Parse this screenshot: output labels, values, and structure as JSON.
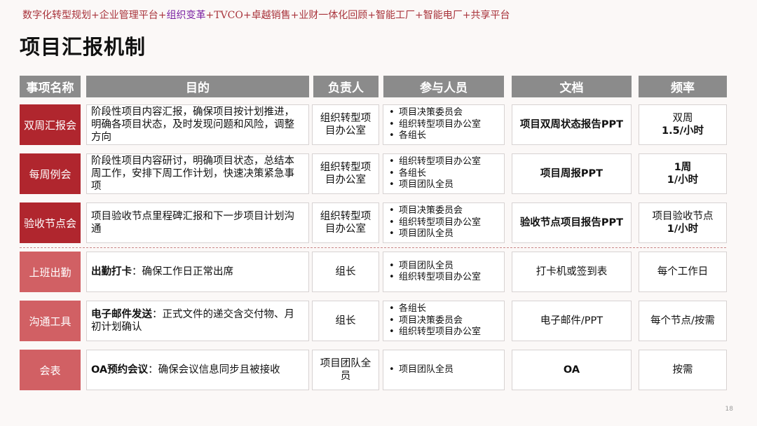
{
  "header": {
    "tags": [
      {
        "text": "数字化转型规划"
      },
      {
        "text": "企业管理平台"
      },
      {
        "text": "组织变革"
      },
      {
        "text": "TVCO"
      },
      {
        "text": "卓越销售"
      },
      {
        "text": "业财一体化回顾"
      },
      {
        "text": "智能工厂"
      },
      {
        "text": "智能电厂"
      },
      {
        "text": "共享平台"
      }
    ],
    "separator": "+",
    "highlight_color": "#7a1fa2",
    "tag_color": "#a8323a"
  },
  "title": "项目汇报机制",
  "table": {
    "columns": [
      "事项名称",
      "目的",
      "负责人",
      "参与人员",
      "文档",
      "频率"
    ],
    "rows": [
      {
        "name": "双周汇报会",
        "purpose_bold": "",
        "purpose": "阶段性项目内容汇报，确保项目按计划推进，明确各项目状态，及时发现问题和风险，调整方向",
        "owner": "组织转型项目办公室",
        "participants": [
          "项目决策委员会",
          "组织转型项目办公室",
          "各组长"
        ],
        "document": "项目双周状态报告PPT",
        "frequency_line1": "双周",
        "frequency_line2": "1.5/小时"
      },
      {
        "name": "每周例会",
        "purpose_bold": "",
        "purpose": "阶段性项目内容研讨，明确项目状态，总结本周工作，安排下周工作计划，快速决策紧急事项",
        "owner": "组织转型项目办公室",
        "participants": [
          "组织转型项目办公室",
          "各组长",
          "项目团队全员"
        ],
        "document": "项目周报PPT",
        "frequency_line1": "1周",
        "frequency_line2": "1/小时"
      },
      {
        "name": "验收节点会",
        "purpose_bold": "",
        "purpose": "项目验收节点里程碑汇报和下一步项目计划沟通",
        "owner": "组织转型项目办公室",
        "participants": [
          "项目决策委员会",
          "组织转型项目办公室",
          "项目团队全员"
        ],
        "document": "验收节点项目报告PPT",
        "frequency_line1": "项目验收节点",
        "frequency_line2": "1/小时"
      },
      {
        "name": "上班出勤",
        "purpose_bold": "出勤打卡",
        "purpose": "：确保工作日正常出席",
        "owner": "组长",
        "participants": [
          "项目团队全员",
          "组织转型项目办公室"
        ],
        "document": "打卡机或签到表",
        "frequency_line1": "每个工作日",
        "frequency_line2": ""
      },
      {
        "name": "沟通工具",
        "purpose_bold": "电子邮件发送",
        "purpose": "：正式文件的递交含交付物、月初计划确认",
        "owner": "组长",
        "participants": [
          "各组长",
          "项目决策委员会",
          "组织转型项目办公室"
        ],
        "document": "电子邮件/PPT",
        "frequency_line1": "每个节点/按需",
        "frequency_line2": ""
      },
      {
        "name": "会表",
        "purpose_bold": "OA预约会议",
        "purpose": "：确保会议信息同步且被接收",
        "owner": "项目团队全员",
        "participants": [
          "项目团队全员"
        ],
        "document": "OA",
        "frequency_line1": "按需",
        "frequency_line2": ""
      }
    ]
  },
  "page_number": "18"
}
